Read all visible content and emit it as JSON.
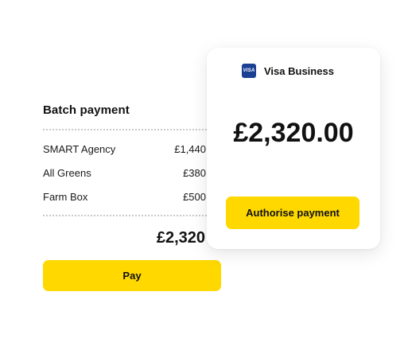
{
  "batch": {
    "title": "Batch payment",
    "payments": [
      {
        "name": "SMART Agency",
        "amount": "£1,440"
      },
      {
        "name": "All Greens",
        "amount": "£380"
      },
      {
        "name": "Farm Box",
        "amount": "£500"
      }
    ],
    "total": "£2,320",
    "pay_label": "Pay"
  },
  "auth": {
    "card_icon": "visa-icon",
    "card_icon_text": "VISA",
    "card_name": "Visa Business",
    "amount": "£2,320.00",
    "button_label": "Authorise payment"
  },
  "colors": {
    "accent": "#ffd800",
    "visa": "#1a3f93",
    "text": "#111111"
  }
}
